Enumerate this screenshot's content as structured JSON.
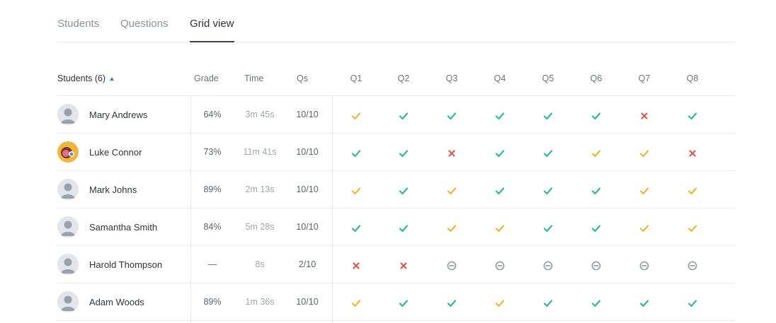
{
  "tabs": [
    {
      "label": "Students",
      "active": false
    },
    {
      "label": "Questions",
      "active": false
    },
    {
      "label": "Grid view",
      "active": true
    }
  ],
  "table": {
    "headers": {
      "students": "Students (6)",
      "grade": "Grade",
      "time": "Time",
      "qs": "Qs",
      "questions": [
        "Q1",
        "Q2",
        "Q3",
        "Q4",
        "Q5",
        "Q6",
        "Q7",
        "Q8"
      ]
    },
    "rows": [
      {
        "name": "Mary Andrews",
        "avatar": "default",
        "grade": "64%",
        "time": "3m 45s",
        "qs": "10/10",
        "results": [
          "partial",
          "correct",
          "correct",
          "correct",
          "correct",
          "correct",
          "incorrect",
          "correct"
        ]
      },
      {
        "name": "Luke Connor",
        "avatar": "custom",
        "grade": "73%",
        "time": "11m 41s",
        "qs": "10/10",
        "results": [
          "correct",
          "correct",
          "incorrect",
          "correct",
          "correct",
          "partial",
          "partial",
          "incorrect"
        ]
      },
      {
        "name": "Mark Johns",
        "avatar": "default",
        "grade": "89%",
        "time": "2m 13s",
        "qs": "10/10",
        "results": [
          "partial",
          "correct",
          "partial",
          "correct",
          "correct",
          "correct",
          "partial",
          "partial"
        ]
      },
      {
        "name": "Samantha Smith",
        "avatar": "default",
        "grade": "84%",
        "time": "5m 28s",
        "qs": "10/10",
        "results": [
          "correct",
          "correct",
          "partial",
          "partial",
          "correct",
          "correct",
          "partial",
          "partial"
        ]
      },
      {
        "name": "Harold Thompson",
        "avatar": "default",
        "grade": "—",
        "time": "8s",
        "qs": "2/10",
        "results": [
          "incorrect",
          "incorrect",
          "unanswered",
          "unanswered",
          "unanswered",
          "unanswered",
          "unanswered",
          "unanswered"
        ]
      },
      {
        "name": "Adam Woods",
        "avatar": "default",
        "grade": "89%",
        "time": "1m 36s",
        "qs": "10/10",
        "results": [
          "partial",
          "correct",
          "correct",
          "partial",
          "correct",
          "correct",
          "correct",
          "correct"
        ]
      }
    ]
  },
  "colors": {
    "correct": "#2fb89a",
    "partial": "#f2b632",
    "incorrect": "#e0584a",
    "unanswered": "#9aa1ab",
    "accent": "#3d7bd9"
  }
}
